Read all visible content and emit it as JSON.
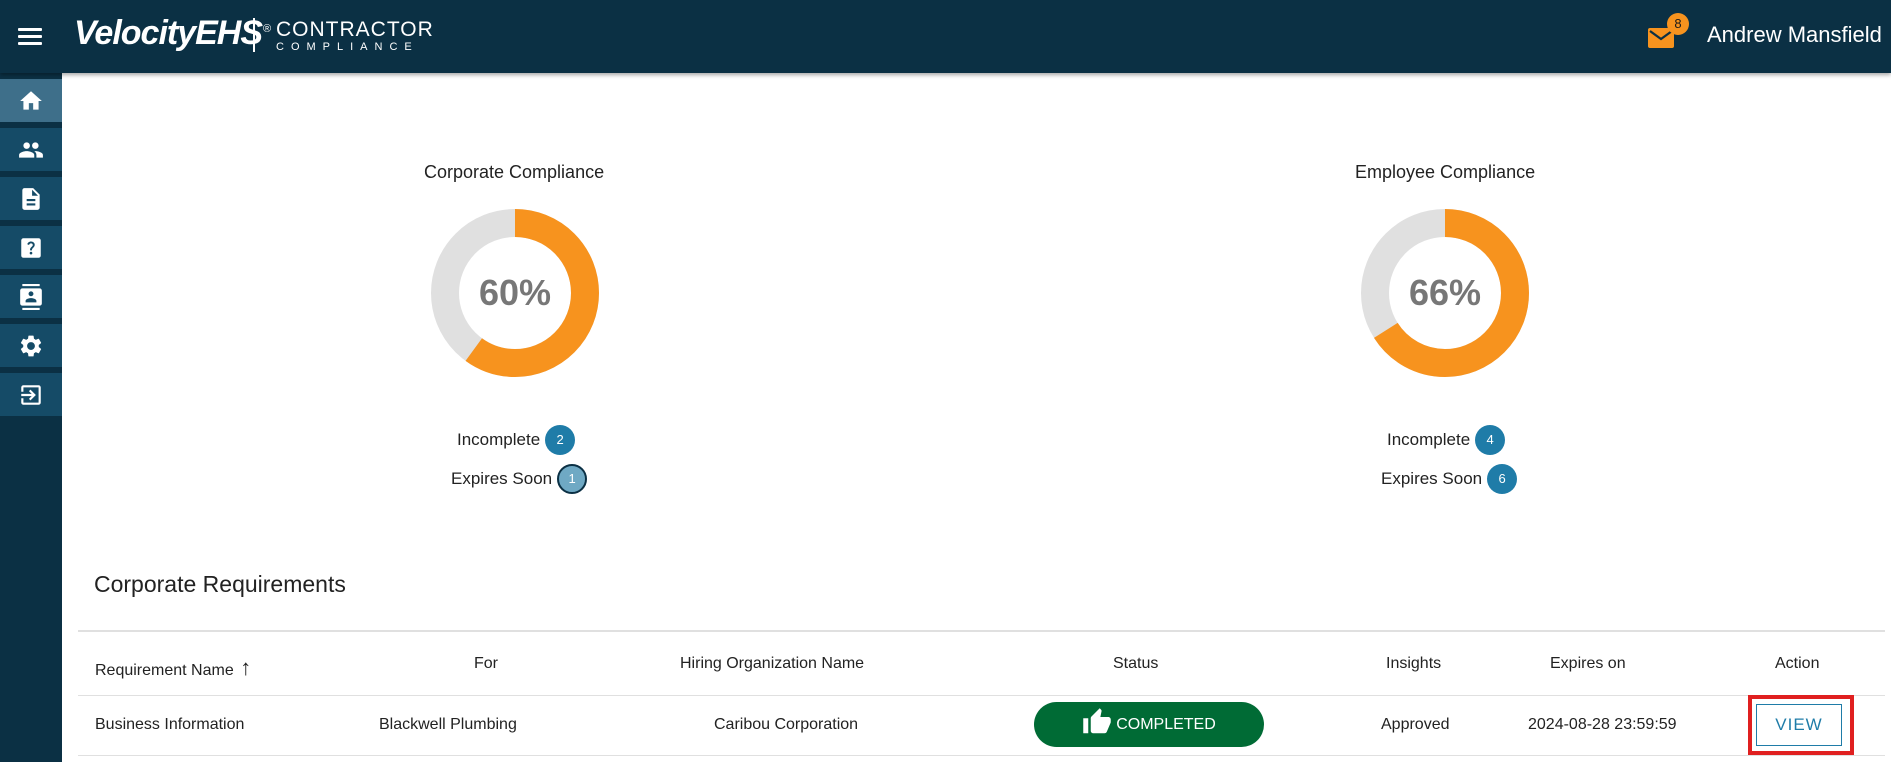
{
  "header": {
    "logo_primary": "VelocityEHS",
    "logo_reg": "®",
    "logo_secondary_line1": "CONTRACTOR",
    "logo_secondary_line2": "COMPLIANCE",
    "mail_count": "8",
    "user_name": "Andrew Mansfield"
  },
  "sidebar": {
    "items": [
      {
        "icon": "home-icon",
        "active": true
      },
      {
        "icon": "people-icon",
        "active": false
      },
      {
        "icon": "document-icon",
        "active": false
      },
      {
        "icon": "help-icon",
        "active": false
      },
      {
        "icon": "contact-card-icon",
        "active": false
      },
      {
        "icon": "gear-icon",
        "active": false
      },
      {
        "icon": "logout-icon",
        "active": false
      }
    ]
  },
  "colors": {
    "navbar": "#0b3044",
    "donut_fill": "#f7931e",
    "donut_track": "#e0e0e0",
    "badge": "#1f7ca8",
    "completed": "#006b35",
    "highlight": "#e02020"
  },
  "charts": [
    {
      "title": "Corporate Compliance",
      "percent": 60,
      "label": "60%",
      "incomplete_label": "Incomplete",
      "incomplete_count": "2",
      "expires_label": "Expires Soon",
      "expires_count": "1"
    },
    {
      "title": "Employee Compliance",
      "percent": 66,
      "label": "66%",
      "incomplete_label": "Incomplete",
      "incomplete_count": "4",
      "expires_label": "Expires Soon",
      "expires_count": "6"
    }
  ],
  "requirements": {
    "title": "Corporate Requirements",
    "columns": [
      "Requirement Name",
      "For",
      "Hiring Organization Name",
      "Status",
      "Insights",
      "Expires on",
      "Action"
    ],
    "sort_indicator": "↑",
    "rows": [
      {
        "requirement_name": "Business Information",
        "for": "Blackwell Plumbing",
        "hiring_org": "Caribou Corporation",
        "status": "COMPLETED",
        "insights": "Approved",
        "expires_on": "2024-08-28 23:59:59",
        "action": "VIEW"
      }
    ]
  }
}
